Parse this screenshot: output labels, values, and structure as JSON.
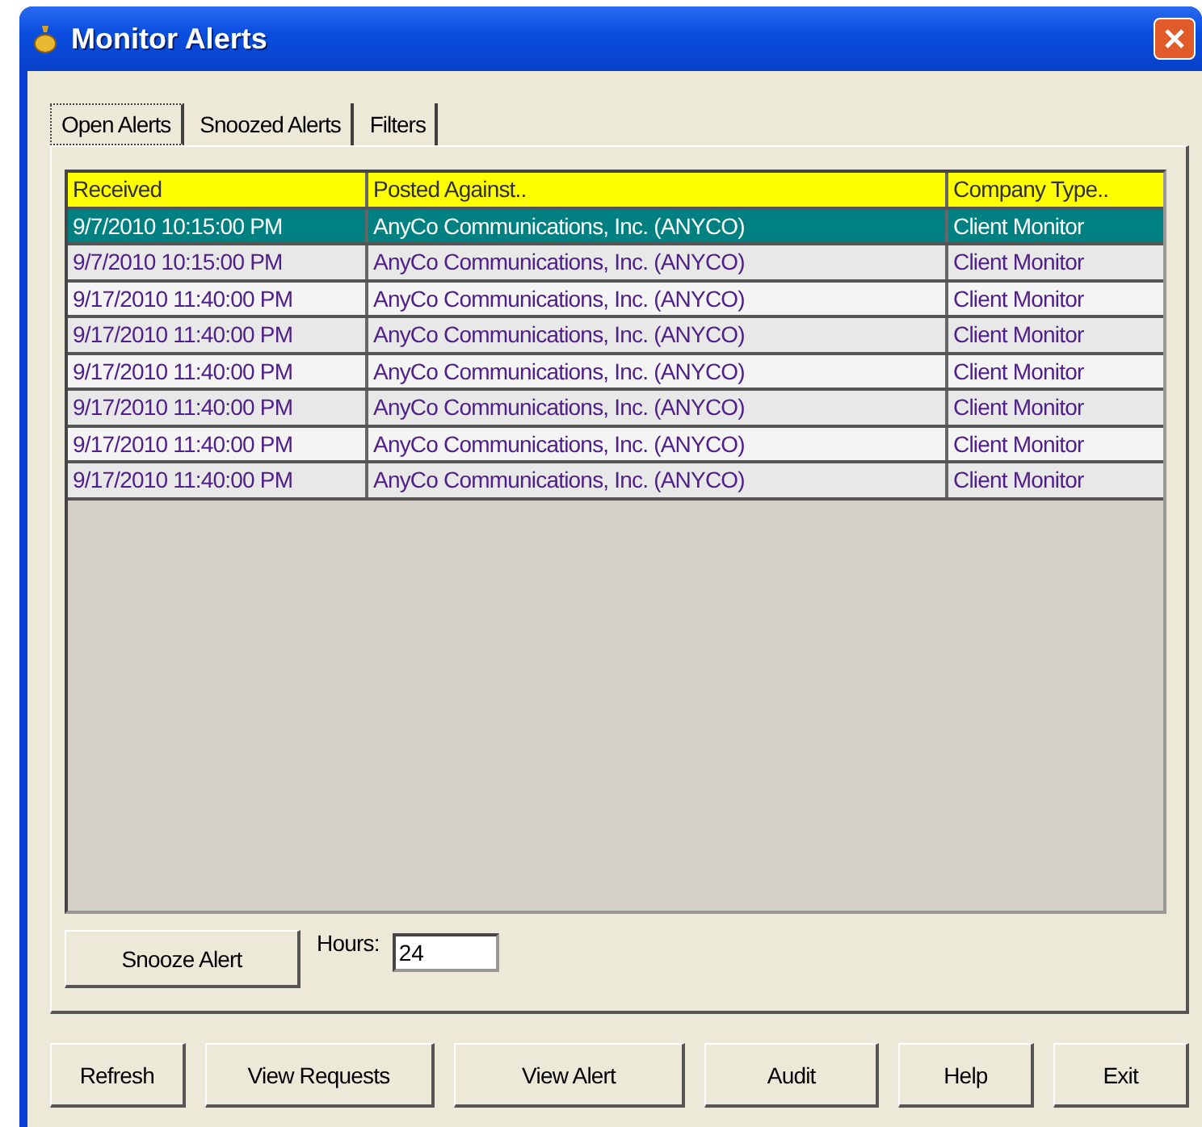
{
  "window": {
    "title": "Monitor Alerts"
  },
  "tabs": [
    {
      "label": "Open Alerts",
      "selected": true
    },
    {
      "label": "Snoozed Alerts",
      "selected": false
    },
    {
      "label": "Filters",
      "selected": false
    }
  ],
  "table": {
    "columns": [
      "Received",
      "Posted Against..",
      "Company Type.."
    ],
    "rows": [
      {
        "cells": [
          "9/7/2010 10:15:00 PM",
          "AnyCo Communications, Inc. (ANYCO)",
          "Client Monitor"
        ],
        "selected": true
      },
      {
        "cells": [
          "9/7/2010 10:15:00 PM",
          "AnyCo Communications, Inc. (ANYCO)",
          "Client Monitor"
        ],
        "selected": false
      },
      {
        "cells": [
          "9/17/2010 11:40:00 PM",
          "AnyCo Communications, Inc. (ANYCO)",
          "Client Monitor"
        ],
        "selected": false
      },
      {
        "cells": [
          "9/17/2010 11:40:00 PM",
          "AnyCo Communications, Inc. (ANYCO)",
          "Client Monitor"
        ],
        "selected": false
      },
      {
        "cells": [
          "9/17/2010 11:40:00 PM",
          "AnyCo Communications, Inc. (ANYCO)",
          "Client Monitor"
        ],
        "selected": false
      },
      {
        "cells": [
          "9/17/2010 11:40:00 PM",
          "AnyCo Communications, Inc. (ANYCO)",
          "Client Monitor"
        ],
        "selected": false
      },
      {
        "cells": [
          "9/17/2010 11:40:00 PM",
          "AnyCo Communications, Inc. (ANYCO)",
          "Client Monitor"
        ],
        "selected": false
      },
      {
        "cells": [
          "9/17/2010 11:40:00 PM",
          "AnyCo Communications, Inc. (ANYCO)",
          "Client Monitor"
        ],
        "selected": false
      }
    ]
  },
  "snooze_button": "Snooze Alert",
  "hours": {
    "label": "Hours:",
    "value": "24"
  },
  "buttons": [
    "Refresh",
    "View Requests",
    "View Alert",
    "Audit",
    "Help",
    "Exit"
  ]
}
